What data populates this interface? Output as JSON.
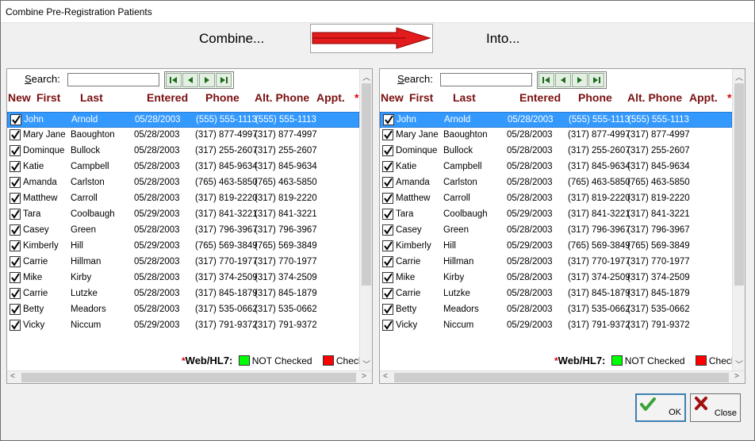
{
  "window": {
    "title": "Combine Pre-Registration Patients"
  },
  "header": {
    "combine_label": "Combine...",
    "into_label": "Into..."
  },
  "search": {
    "label_prefix": "S",
    "label_rest": "earch:",
    "value": ""
  },
  "columns": {
    "new": "New",
    "first": "First",
    "last": "Last",
    "entered": "Entered",
    "phone": "Phone",
    "alt_phone": "Alt. Phone",
    "appt": "Appt.",
    "star": "*"
  },
  "rows": [
    {
      "first": "John",
      "last": "Arnold",
      "entered": "05/28/2003",
      "phone": "(555) 555-1113",
      "alt": "(555) 555-1113",
      "checked": true,
      "selected": true
    },
    {
      "first": "Mary Jane",
      "last": "Baoughton",
      "entered": "05/28/2003",
      "phone": "(317) 877-4997",
      "alt": "(317) 877-4997",
      "checked": true
    },
    {
      "first": "Dominque",
      "last": "Bullock",
      "entered": "05/28/2003",
      "phone": "(317) 255-2607",
      "alt": "(317) 255-2607",
      "checked": true
    },
    {
      "first": "Katie",
      "last": "Campbell",
      "entered": "05/28/2003",
      "phone": "(317) 845-9634",
      "alt": "(317) 845-9634",
      "checked": true
    },
    {
      "first": "Amanda",
      "last": "Carlston",
      "entered": "05/28/2003",
      "phone": "(765) 463-5850",
      "alt": "(765) 463-5850",
      "checked": true
    },
    {
      "first": "Matthew",
      "last": "Carroll",
      "entered": "05/28/2003",
      "phone": "(317) 819-2220",
      "alt": "(317) 819-2220",
      "checked": true
    },
    {
      "first": "Tara",
      "last": "Coolbaugh",
      "entered": "05/29/2003",
      "phone": "(317) 841-3221",
      "alt": "(317) 841-3221",
      "checked": true
    },
    {
      "first": "Casey",
      "last": "Green",
      "entered": "05/28/2003",
      "phone": "(317) 796-3967",
      "alt": "(317) 796-3967",
      "checked": true
    },
    {
      "first": "Kimberly",
      "last": "Hill",
      "entered": "05/29/2003",
      "phone": "(765) 569-3849",
      "alt": "(765) 569-3849",
      "checked": true
    },
    {
      "first": "Carrie",
      "last": "Hillman",
      "entered": "05/28/2003",
      "phone": "(317) 770-1977",
      "alt": "(317) 770-1977",
      "checked": true
    },
    {
      "first": "Mike",
      "last": "Kirby",
      "entered": "05/28/2003",
      "phone": "(317) 374-2509",
      "alt": "(317) 374-2509",
      "checked": true
    },
    {
      "first": "Carrie",
      "last": "Lutzke",
      "entered": "05/28/2003",
      "phone": "(317) 845-1879",
      "alt": "(317) 845-1879",
      "checked": true
    },
    {
      "first": "Betty",
      "last": "Meadors",
      "entered": "05/28/2003",
      "phone": "(317) 535-0662",
      "alt": "(317) 535-0662",
      "checked": true
    },
    {
      "first": "Vicky",
      "last": "Niccum",
      "entered": "05/29/2003",
      "phone": "(317) 791-9372",
      "alt": "(317) 791-9372",
      "checked": true
    }
  ],
  "legend": {
    "star": "*",
    "label": "Web/HL7:",
    "not_checked": "NOT Checked",
    "checked": "Checked",
    "not_checked_color": "#00ff00",
    "checked_color": "#ff0000"
  },
  "buttons": {
    "ok": "OK",
    "close": "Close"
  },
  "icons": {
    "nav": [
      "first-record-icon",
      "prev-record-icon",
      "next-record-icon",
      "last-record-icon"
    ],
    "ok": "checkmark-icon",
    "close": "x-icon"
  }
}
